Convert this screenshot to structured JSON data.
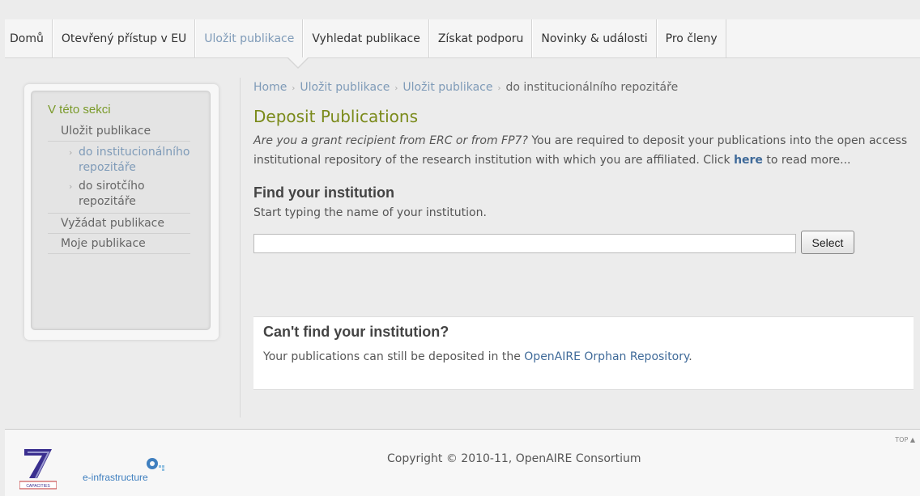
{
  "nav": {
    "items": [
      {
        "label": "Domů"
      },
      {
        "label": "Otevřený přístup v EU"
      },
      {
        "label": "Uložit publikace"
      },
      {
        "label": "Vyhledat publikace"
      },
      {
        "label": "Získat podporu"
      },
      {
        "label": "Novinky & události"
      },
      {
        "label": "Pro členy"
      }
    ],
    "active_index": 2
  },
  "sidebar": {
    "title": "V této sekci",
    "items": [
      {
        "label": "Uložit publikace"
      },
      {
        "label": "do institucionálního repozitáře"
      },
      {
        "label": "do sirotčího repozitáře"
      },
      {
        "label": "Vyžádat publikace"
      },
      {
        "label": "Moje publikace"
      }
    ]
  },
  "breadcrumb": {
    "items": [
      "Home",
      "Uložit publikace",
      "Uložit publikace"
    ],
    "current": "do institucionálního repozitáře"
  },
  "main": {
    "title": "Deposit Publications",
    "intro_italic": "Are you a grant recipient from ERC or from FP7?",
    "intro_rest": " You are required to deposit your publications into the open access institutional repository of the research institution with which you are affiliated. Click ",
    "intro_link": "here",
    "intro_end": " to read more...",
    "find_heading": "Find your institution",
    "find_hint": "Start typing the name of your institution.",
    "search_value": "",
    "select_label": "Select",
    "orphan_heading": "Can't find your institution?",
    "orphan_text": "Your publications can still be deposited in the ",
    "orphan_link": "OpenAIRE Orphan Repository",
    "orphan_end": "."
  },
  "footer": {
    "copyright": "Copyright © 2010-11, OpenAIRE Consortium",
    "top_label": "TOP ▲",
    "capacities_label": "CAPACITIES",
    "einfra_label": "e-infrastructure"
  },
  "colors": {
    "accent_green": "#7a8a1a",
    "link_blue": "#7f9bb8",
    "strong_link": "#3f6a99"
  }
}
